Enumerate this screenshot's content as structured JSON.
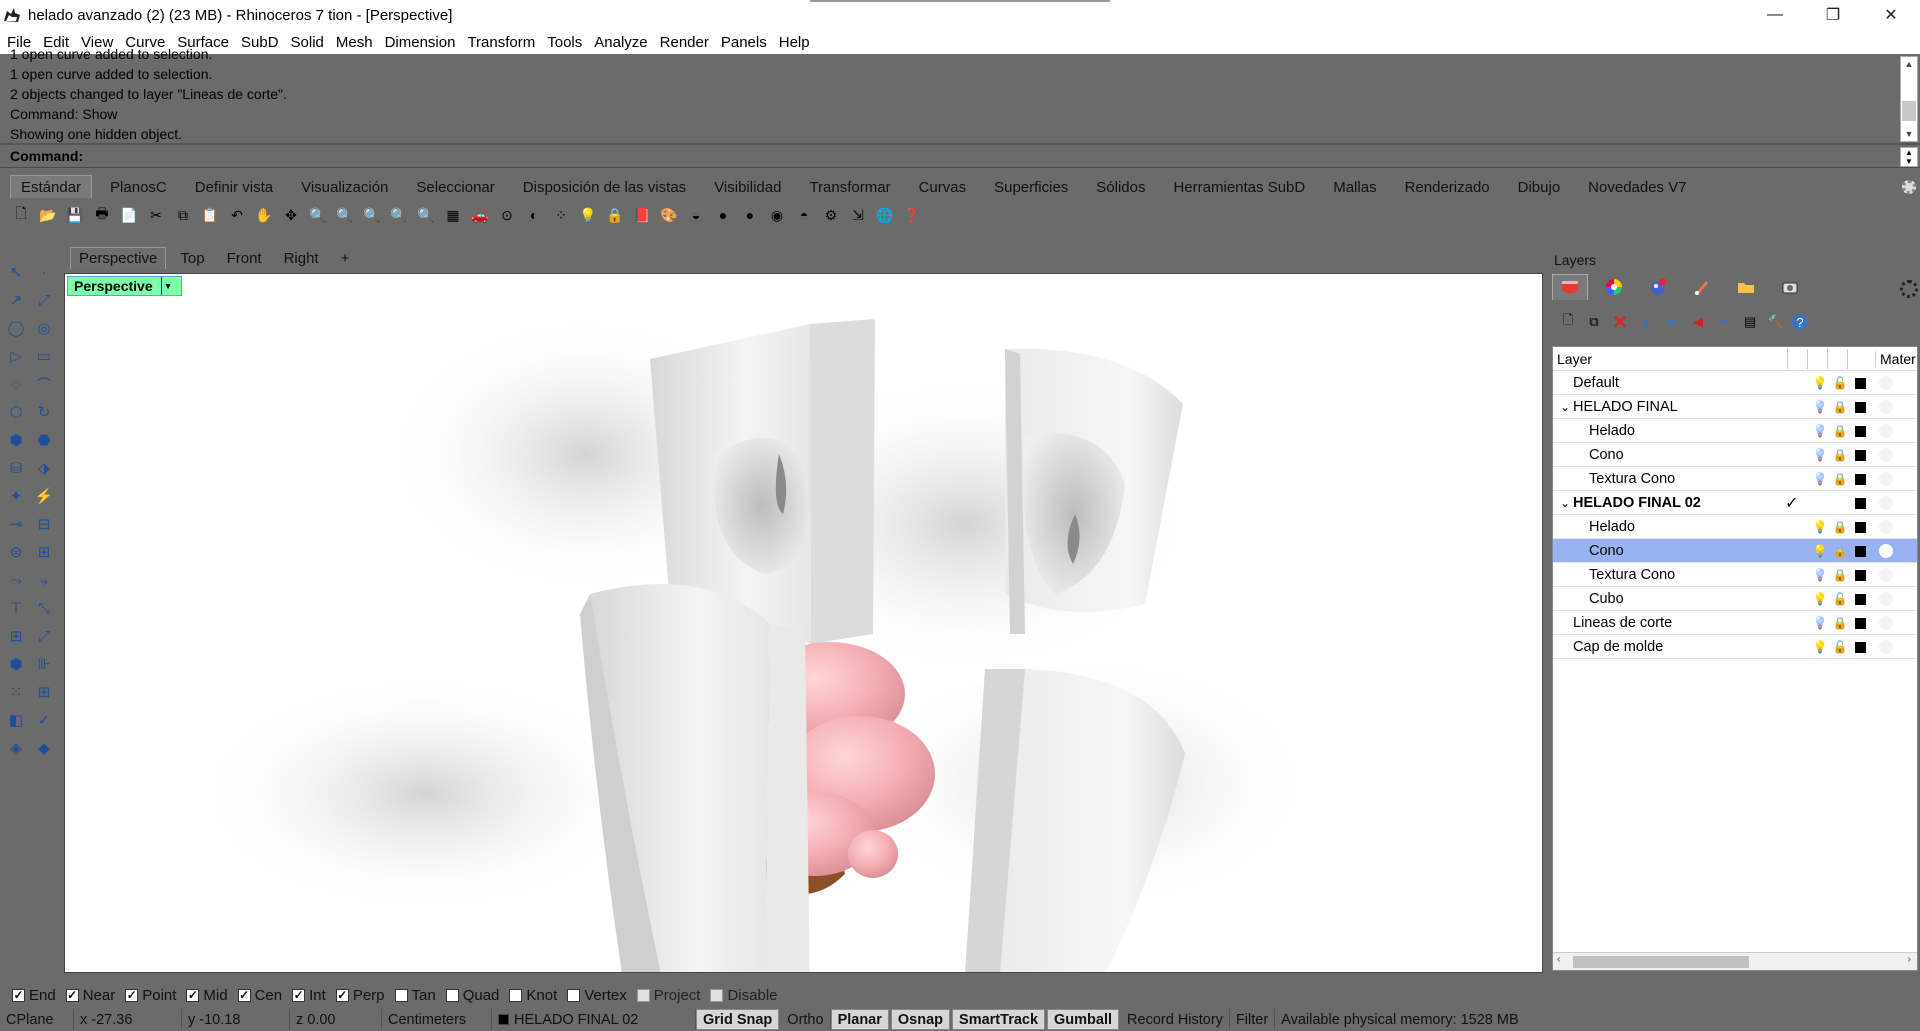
{
  "window": {
    "title": "helado avanzado (2) (23 MB) - Rhinoceros 7 tion - [Perspective]",
    "minimize": "—",
    "maximize": "❐",
    "close": "✕"
  },
  "menu": [
    "File",
    "Edit",
    "View",
    "Curve",
    "Surface",
    "SubD",
    "Solid",
    "Mesh",
    "Dimension",
    "Transform",
    "Tools",
    "Analyze",
    "Render",
    "Panels",
    "Help"
  ],
  "history": {
    "cut_line": "1 open curve added to selection.",
    "lines": [
      "1 open curve added to selection.",
      "2 objects changed to layer \"Lineas de corte\".",
      "Command: Show",
      "Showing one hidden object."
    ]
  },
  "command": {
    "label": "Command:",
    "value": ""
  },
  "toolbar_tabs": [
    "Estándar",
    "PlanosC",
    "Definir vista",
    "Visualización",
    "Seleccionar",
    "Disposición de las vistas",
    "Visibilidad",
    "Transformar",
    "Curvas",
    "Superficies",
    "Sólidos",
    "Herramientas SubD",
    "Mallas",
    "Renderizado",
    "Dibujo",
    "Novedades V7"
  ],
  "toolbar_icons": [
    "new-file-icon",
    "open-icon",
    "save-icon",
    "print-icon",
    "import-icon",
    "cut-icon",
    "copy-icon",
    "paste-icon",
    "undo-icon",
    "pan-hand-icon",
    "rotate-view-icon",
    "zoom-dynamic-icon",
    "zoom-window-icon",
    "zoom-extents-icon",
    "zoom-selected-icon",
    "zoom-all-icon",
    "four-views-icon",
    "car-icon",
    "cplane-icon",
    "named-view-icon",
    "select-points-icon",
    "light-icon",
    "lock-icon",
    "layer-icon",
    "color-wheel-icon",
    "wireframe-icon",
    "shaded-icon",
    "rendered-icon",
    "render-icon",
    "materials-icon",
    "settings-icon",
    "transform-icon",
    "globe-icon",
    "help-icon"
  ],
  "toolbar_glyphs": [
    "🗋",
    "📂",
    "💾",
    "🖶",
    "📄",
    "✂",
    "⧉",
    "📋",
    "↶",
    "✋",
    "✥",
    "🔍",
    "🔍",
    "🔍",
    "🔍",
    "🔍",
    "▦",
    "🚗",
    "⊙",
    "◐",
    "⁘",
    "💡",
    "🔒",
    "📕",
    "🎨",
    "◒",
    "●",
    "●",
    "◉",
    "◓",
    "⚙",
    "⇲",
    "🌐",
    "❓"
  ],
  "viewport_tabs": [
    "Perspective",
    "Top",
    "Front",
    "Right",
    "+"
  ],
  "viewport": {
    "label": "Perspective",
    "dropdown": "▼"
  },
  "layers": {
    "title": "Layers",
    "columns": {
      "layer": "Layer",
      "material": "Mater"
    },
    "rows": [
      {
        "name": "Default",
        "indent": 1,
        "expand": "",
        "bold": false,
        "selected": false,
        "current": "",
        "bulb": "on",
        "lock": "open",
        "mat": false
      },
      {
        "name": "HELADO FINAL",
        "indent": 1,
        "expand": "⌄",
        "bold": false,
        "selected": false,
        "current": "",
        "bulb": "off",
        "lock": "closed",
        "mat": false
      },
      {
        "name": "Helado",
        "indent": 2,
        "expand": "",
        "bold": false,
        "selected": false,
        "current": "",
        "bulb": "off",
        "lock": "closed",
        "mat": false
      },
      {
        "name": "Cono",
        "indent": 2,
        "expand": "",
        "bold": false,
        "selected": false,
        "current": "",
        "bulb": "off",
        "lock": "closed",
        "mat": false
      },
      {
        "name": "Textura Cono",
        "indent": 2,
        "expand": "",
        "bold": false,
        "selected": false,
        "current": "",
        "bulb": "off",
        "lock": "closed",
        "mat": false
      },
      {
        "name": "HELADO FINAL 02",
        "indent": 1,
        "expand": "⌄",
        "bold": true,
        "selected": false,
        "current": "✓",
        "bulb": "",
        "lock": "",
        "mat": false
      },
      {
        "name": "Helado",
        "indent": 2,
        "expand": "",
        "bold": false,
        "selected": false,
        "current": "",
        "bulb": "on",
        "lock": "closed",
        "mat": false
      },
      {
        "name": "Cono",
        "indent": 2,
        "expand": "",
        "bold": false,
        "selected": true,
        "current": "",
        "bulb": "on",
        "lock": "closed",
        "mat": true
      },
      {
        "name": "Textura Cono",
        "indent": 2,
        "expand": "",
        "bold": false,
        "selected": false,
        "current": "",
        "bulb": "off",
        "lock": "closed",
        "mat": false
      },
      {
        "name": "Cubo",
        "indent": 2,
        "expand": "",
        "bold": false,
        "selected": false,
        "current": "",
        "bulb": "on",
        "lock": "open",
        "mat": false
      },
      {
        "name": "Lineas de corte",
        "indent": 1,
        "expand": "",
        "bold": false,
        "selected": false,
        "current": "",
        "bulb": "off",
        "lock": "closed",
        "mat": false
      },
      {
        "name": "Cap de molde",
        "indent": 1,
        "expand": "",
        "bold": false,
        "selected": false,
        "current": "",
        "bulb": "on",
        "lock": "open",
        "mat": false
      }
    ]
  },
  "osnaps": [
    {
      "label": "End",
      "checked": true,
      "enabled": true
    },
    {
      "label": "Near",
      "checked": true,
      "enabled": true
    },
    {
      "label": "Point",
      "checked": true,
      "enabled": true
    },
    {
      "label": "Mid",
      "checked": true,
      "enabled": true
    },
    {
      "label": "Cen",
      "checked": true,
      "enabled": true
    },
    {
      "label": "Int",
      "checked": true,
      "enabled": true
    },
    {
      "label": "Perp",
      "checked": true,
      "enabled": true
    },
    {
      "label": "Tan",
      "checked": false,
      "enabled": true
    },
    {
      "label": "Quad",
      "checked": false,
      "enabled": true
    },
    {
      "label": "Knot",
      "checked": false,
      "enabled": true
    },
    {
      "label": "Vertex",
      "checked": false,
      "enabled": true
    },
    {
      "label": "Project",
      "checked": false,
      "enabled": false
    },
    {
      "label": "Disable",
      "checked": false,
      "enabled": false
    }
  ],
  "status": {
    "cplane": "CPlane",
    "x": "x -27.36",
    "y": "y -10.18",
    "z": "z 0.00",
    "units": "Centimeters",
    "layer": "HELADO FINAL 02",
    "grid_snap": "Grid Snap",
    "ortho": "Ortho",
    "planar": "Planar",
    "osnap": "Osnap",
    "smarttrack": "SmartTrack",
    "gumball": "Gumball",
    "record_history": "Record History",
    "filter": "Filter",
    "memory": "Available physical memory: 1528 MB"
  },
  "colors": {
    "ui_gray": "#6b6b6b",
    "viewport_label": "#7effa9",
    "selected_layer": "#99b3f2",
    "ice_cream": "#f3b1b6",
    "cone": "#8b4f2a"
  }
}
